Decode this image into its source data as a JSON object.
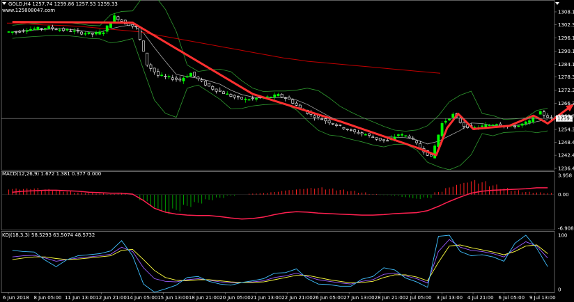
{
  "header": {
    "symbol_line": "GOLD,H4 1257.74 1259.86 1257.53 1259.33",
    "website": "www.125808047.com"
  },
  "colors": {
    "background": "#000000",
    "bull": "#00ff00",
    "bear": "#ffffff",
    "ma_long": "#c00000",
    "bands": "#2f9a2f",
    "annotation": "#ff3030",
    "macd_pos": "#ff2020",
    "macd_neg": "#00a000",
    "kdj_k": "#9b5cff",
    "kdj_d": "#ffff40",
    "kdj_j": "#40c0ff"
  },
  "chart_data": [
    {
      "type": "candlestick",
      "title": "GOLD,H4",
      "ylim": [
        1236.45,
        1308.15
      ],
      "yticks": [
        "1308.15",
        "1302.30",
        "1296.15",
        "1290.15",
        "1284.15",
        "1278.30",
        "1272.30",
        "1266.30",
        "1260.30",
        "1254.30",
        "1248.45",
        "1242.45",
        "1236.45"
      ],
      "current_price": "1259.33",
      "x_labels": [
        "6 Jun 2018",
        "8 Jun 05:00",
        "11 Jun 13:00",
        "12 Jun 21:00",
        "14 Jun 05:00",
        "15 Jun 13:00",
        "18 Jun 21:00",
        "20 Jun 05:00",
        "21 Jun 13:00",
        "22 Jun 21:00",
        "26 Jun 05:00",
        "27 Jun 13:00",
        "28 Jun 21:00",
        "2 Jul 05:00",
        "3 Jul 13:00",
        "4 Jul 21:00",
        "6 Jul 05:00",
        "9 Jul 13:00"
      ],
      "close_path": [
        1299,
        1300,
        1300.5,
        1301,
        1300,
        1299.5,
        1298.5,
        1298,
        1299,
        1306,
        1303,
        1301,
        1284,
        1279,
        1278,
        1277,
        1280,
        1276,
        1273,
        1271,
        1269,
        1268,
        1268.5,
        1269,
        1270,
        1268,
        1264,
        1261,
        1259,
        1257,
        1255,
        1253,
        1252,
        1250,
        1249,
        1252,
        1251,
        1246,
        1241.5,
        1257,
        1261,
        1256,
        1255,
        1256,
        1257,
        1255.5,
        1256,
        1258,
        1262,
        1259.3
      ],
      "ma_long": [
        1303,
        1303,
        1302.5,
        1302.2,
        1302,
        1301.8,
        1301.5,
        1301,
        1300.5,
        1300,
        1299.5,
        1299,
        1298,
        1297,
        1296,
        1295,
        1294,
        1293,
        1292,
        1291,
        1290,
        1289,
        1288,
        1287,
        1286.3,
        1285.5,
        1285,
        1284.5,
        1284,
        1283.5,
        1283,
        1282.5,
        1282,
        1281.5,
        1281,
        1280.5,
        1280
      ],
      "annotation_path": [
        [
          0,
          1303.5
        ],
        [
          11,
          1303.2
        ],
        [
          22,
          1270.5
        ],
        [
          30,
          1258
        ],
        [
          37,
          1246
        ],
        [
          38.8,
          1242.5
        ],
        [
          39.8,
          1255
        ],
        [
          40.8,
          1261.5
        ],
        [
          42.2,
          1254.5
        ],
        [
          45.5,
          1256
        ],
        [
          47.7,
          1260.6
        ],
        [
          48.5,
          1258.5
        ],
        [
          49,
          1257
        ],
        [
          51.3,
          1265.5
        ]
      ]
    },
    {
      "type": "bar",
      "title": "MACD(12,26,9) 1.672 1.381 0.377 0.000",
      "ylim": [
        -6.908,
        3.958
      ],
      "yticks": [
        "3.958",
        "0.00",
        "-6.908"
      ],
      "histogram": [
        1.1,
        1.1,
        1.2,
        1.0,
        0.8,
        0.6,
        0.4,
        0.3,
        0.2,
        0.1,
        0.2,
        0.0,
        -1.2,
        -2.5,
        -3.5,
        -3.0,
        -2.2,
        -1.6,
        -1.0,
        -0.6,
        -0.2,
        0.0,
        0.2,
        0.3,
        0.5,
        0.8,
        1.0,
        1.2,
        1.3,
        1.1,
        0.9,
        0.7,
        0.4,
        0.1,
        -0.1,
        -0.2,
        -0.5,
        -0.8,
        -0.6,
        0.5,
        1.4,
        2.1,
        2.6,
        2.4,
        1.8,
        1.2,
        0.8,
        0.5,
        0.4,
        0.3
      ],
      "signal": [
        0.5,
        0.7,
        0.8,
        0.9,
        0.9,
        0.8,
        0.7,
        0.5,
        0.4,
        0.3,
        0.3,
        0.1,
        -1.2,
        -2.8,
        -3.6,
        -4.0,
        -4.2,
        -4.3,
        -4.3,
        -4.5,
        -4.8,
        -5.0,
        -4.9,
        -4.6,
        -4.1,
        -3.7,
        -3.5,
        -3.6,
        -3.8,
        -3.9,
        -4.0,
        -4.1,
        -4.2,
        -4.2,
        -4.1,
        -3.9,
        -3.8,
        -3.7,
        -3.3,
        -2.4,
        -1.4,
        -0.5,
        0.3,
        0.7,
        0.9,
        1.0,
        1.1,
        1.2,
        1.4,
        1.4
      ]
    },
    {
      "type": "line",
      "title": "KDJ(18,3,3) 58.5293 63.5074 48.5732",
      "ylim": [
        0,
        100
      ],
      "yticks": [
        "100",
        "0"
      ],
      "series": [
        {
          "key": "k",
          "values": [
            60,
            62,
            63,
            58,
            52,
            55,
            58,
            60,
            62,
            65,
            78,
            70,
            40,
            20,
            15,
            14,
            18,
            20,
            17,
            14,
            12,
            13,
            14,
            16,
            22,
            25,
            30,
            24,
            18,
            15,
            12,
            10,
            15,
            18,
            28,
            30,
            25,
            20,
            12,
            70,
            92,
            78,
            72,
            70,
            66,
            60,
            75,
            88,
            80,
            58
          ]
        },
        {
          "key": "d",
          "values": [
            55,
            58,
            60,
            60,
            57,
            55,
            56,
            58,
            60,
            62,
            72,
            74,
            55,
            35,
            22,
            17,
            16,
            18,
            18,
            16,
            14,
            13,
            13,
            14,
            18,
            22,
            26,
            26,
            22,
            18,
            15,
            12,
            13,
            15,
            22,
            27,
            27,
            23,
            16,
            50,
            80,
            82,
            77,
            73,
            69,
            64,
            70,
            80,
            82,
            66
          ]
        },
        {
          "key": "j",
          "values": [
            72,
            70,
            69,
            54,
            42,
            55,
            62,
            64,
            66,
            71,
            90,
            62,
            10,
            -5,
            1,
            8,
            22,
            24,
            15,
            10,
            8,
            13,
            16,
            20,
            30,
            31,
            38,
            20,
            10,
            9,
            6,
            6,
            19,
            24,
            40,
            36,
            21,
            14,
            4,
            98,
            100,
            70,
            62,
            64,
            60,
            52,
            85,
            100,
            76,
            42
          ]
        }
      ]
    }
  ]
}
